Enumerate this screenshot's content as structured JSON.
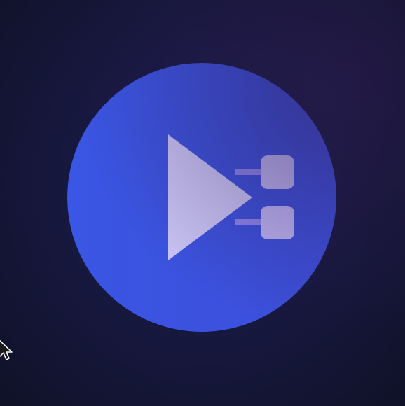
{
  "colors": {
    "background_center": "#1c1d4a",
    "background_edge": "#101228",
    "circle_light": "#3a56e4",
    "circle_dark": "#3d4ed9",
    "play_triangle": "#cbc6f6",
    "node_square": "#c0b7f4",
    "connector_line": "#8f86ee",
    "cursor_fill": "#1a1a1a",
    "cursor_outline": "#ffffff"
  },
  "icons": {
    "logo": "play-pipeline-icon",
    "triangle": "play-triangle-icon",
    "node_top": "node-square-icon",
    "node_bottom": "node-square-icon",
    "cursor": "arrow-cursor-icon"
  }
}
